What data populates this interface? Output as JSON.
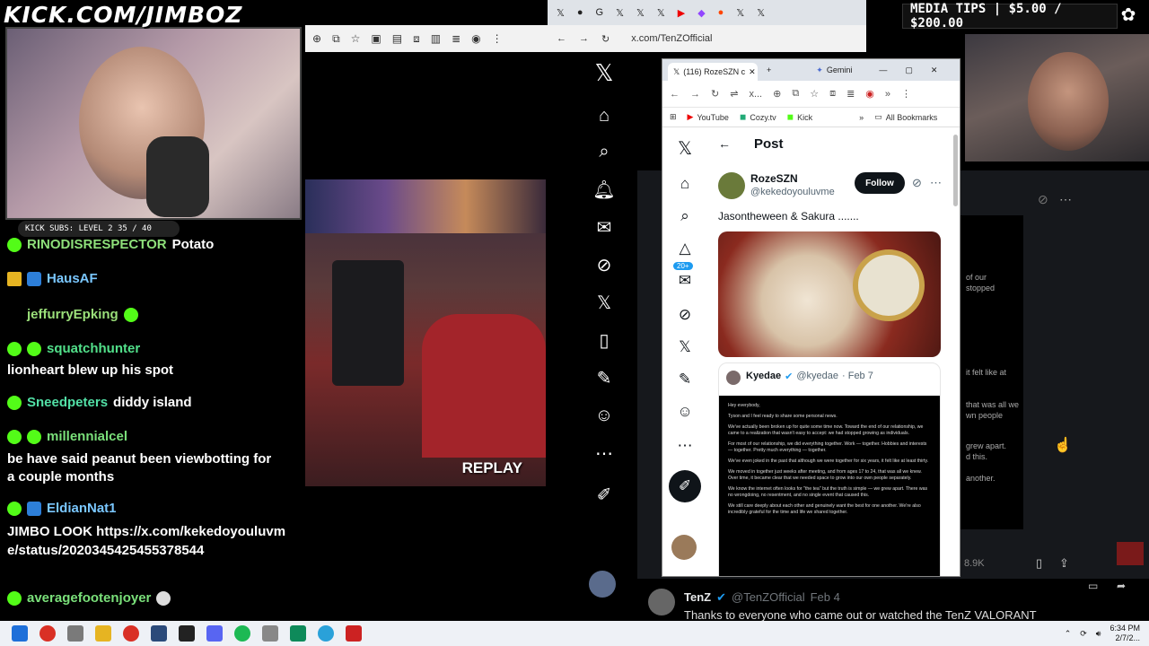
{
  "overlay": {
    "stream_url": "KICK.COM/JIMBOZ",
    "media_tips": "MEDIA TIPS | $5.00 / $200.00",
    "kick_subs": "KICK SUBS: LEVEL 2 35 / 40"
  },
  "chat": {
    "messages": [
      {
        "user": "RINODISRESPECTOR",
        "text": "Potato",
        "badges": [
          "green"
        ]
      },
      {
        "user": "HausAF",
        "text": "",
        "badges": [
          "gold",
          "blue"
        ]
      },
      {
        "user": "jeffurryEpking",
        "text": "",
        "badges": []
      },
      {
        "user": "squatchhunter",
        "text": "lionheart blew up his spot",
        "badges": [
          "green",
          "green"
        ]
      },
      {
        "user": "Sneedpeters",
        "text": "diddy island",
        "badges": [
          "green"
        ]
      },
      {
        "user": "millennialcel",
        "text": "be have said peanut been viewbotting for a couple months",
        "badges": [
          "green",
          "green"
        ]
      },
      {
        "user": "EldianNat1",
        "text": "JIMBO LOOK https://x.com/kekedoyouluvme/status/2020345425455378544",
        "badges": [
          "green",
          "blue"
        ]
      },
      {
        "user": "averagefootenjoyer",
        "text": "",
        "badges": [
          "green"
        ]
      }
    ]
  },
  "game": {
    "replay_label": "REPLAY"
  },
  "bg_browser": {
    "url": "x.com/TenZOfficial",
    "bottom_post": {
      "name": "TenZ",
      "handle": "@TenZOfficial",
      "date": "Feb 4",
      "text": "Thanks to everyone who came out or watched the TenZ VALORANT"
    },
    "views": "8.9K",
    "side_text": [
      "of our",
      "stopped",
      "it felt like at",
      "that was all we",
      "wn people",
      "grew apart.",
      "d this.",
      "another."
    ]
  },
  "popup": {
    "tab_title": "(116) RozeSZN c",
    "gemini": "Gemini",
    "address": "x...",
    "bookmarks": [
      "YouTube",
      "Cozy.tv",
      "Kick"
    ],
    "all_bookmarks": "All Bookmarks",
    "page_title": "Post",
    "author_name": "RozeSZN",
    "author_handle": "@kekedoyouluvme",
    "follow_label": "Follow",
    "post_text": "Jasontheween & Sakura .......",
    "badge_count": "20+",
    "quoted": {
      "name": "Kyedae",
      "handle": "@kyedae",
      "date": "· Feb 7",
      "lines": [
        "Hey everybody,",
        "Tyson and I feel ready to share some personal news.",
        "We've actually been broken up for quite some time now. Toward the end of our relationship, we came to a realization that wasn't easy to accept: we had stopped growing as individuals.",
        "For most of our relationship, we did everything together. Work — together. Hobbies and interests — together. Pretty much everything — together.",
        "We've even joked in the past that although we were together for six years, it felt like at least thirty.",
        "We moved in together just weeks after meeting, and from ages 17 to 24, that was all we knew. Over time, it became clear that we needed space to grow into our own people separately.",
        "We know the internet often looks for \"the tea\" but the truth is simple — we grew apart. There was no wrongdoing, no resentment, and no single event that caused this.",
        "We still care deeply about each other and genuinely want the best for one another. We're also incredibly grateful for the time and life we shared together."
      ]
    }
  },
  "taskbar": {
    "time": "6:34 PM",
    "date": "2/7/2..."
  }
}
